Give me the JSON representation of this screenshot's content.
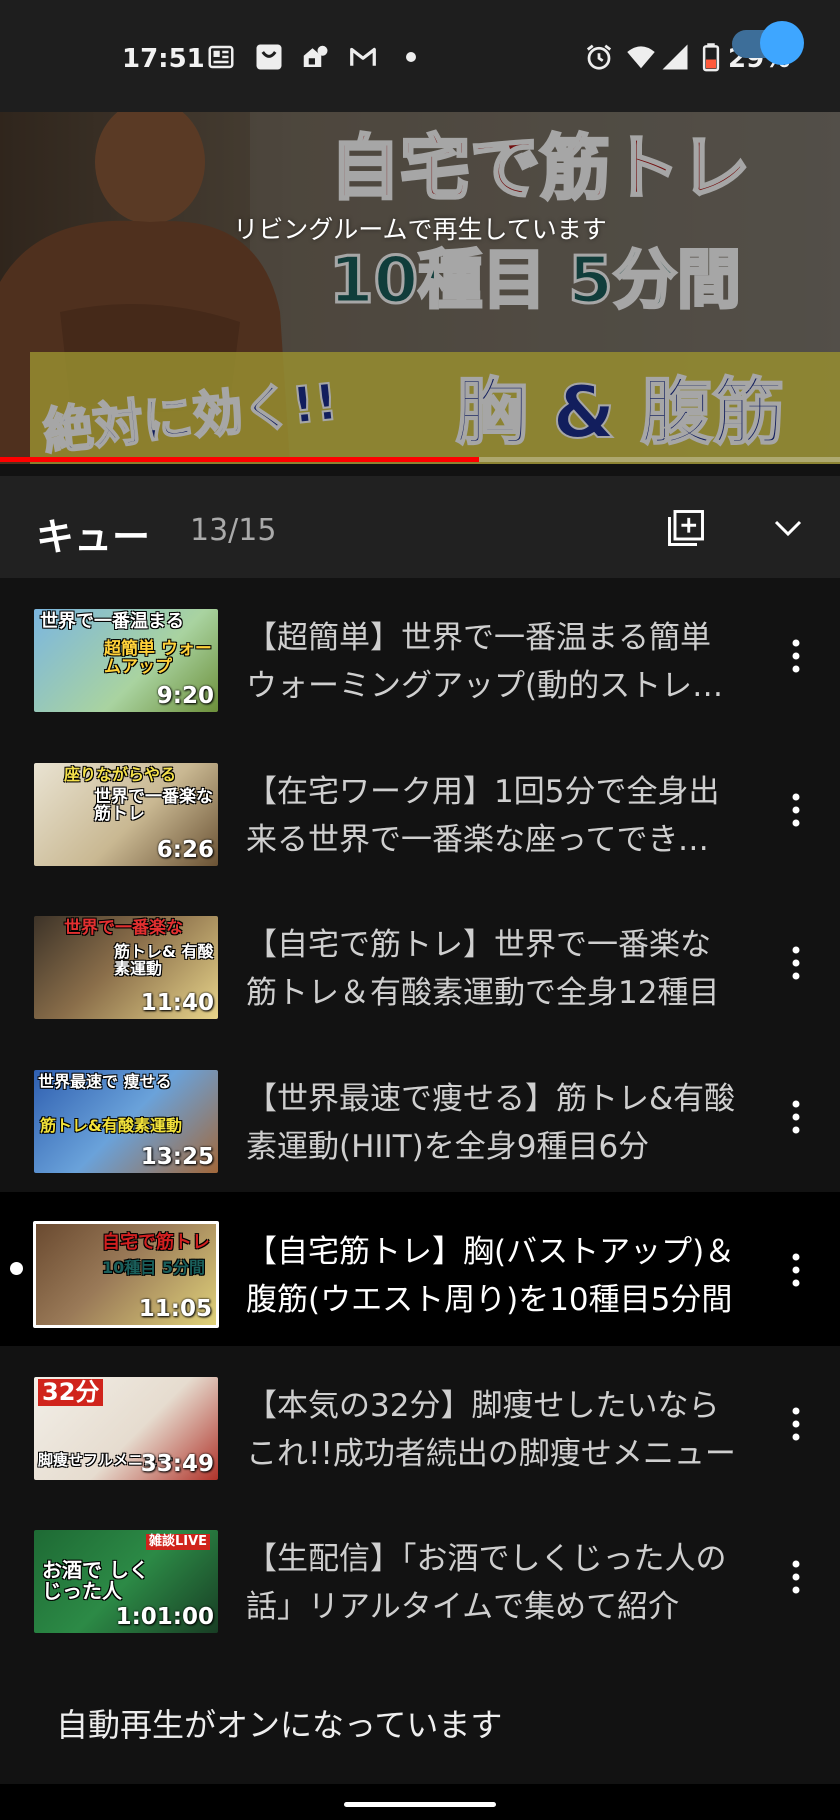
{
  "status_bar": {
    "time": "17:51",
    "battery": "29%",
    "icons": [
      "news-icon",
      "shopping-bag-icon",
      "home-app-icon",
      "gmail-icon",
      "notification-dot-icon",
      "alarm-icon",
      "wifi-icon",
      "signal-icon",
      "battery-icon"
    ]
  },
  "player": {
    "casting_text": "リビングルームで再生しています",
    "thumbnail_text": {
      "line1": "自宅で筋トレ",
      "line2": "10種目 5分間",
      "line3a": "絶対に効く!!",
      "line3b": "胸 & 腹筋"
    },
    "progress": 0.57,
    "progress_color": "#ff0000"
  },
  "queue": {
    "title": "キュー",
    "count": "13/15",
    "items": [
      {
        "title": "【超簡単】世界で一番温まる簡単ウォーミングアップ(動的ストレッチ)",
        "duration": "9:20",
        "thumb_text": "世界で一番温まる",
        "thumb_text2": "超簡単 ウォームアップ",
        "current": false
      },
      {
        "title": "【在宅ワーク用】1回5分で全身出来る世界で一番楽な座ってできる筋トレ",
        "duration": "6:26",
        "thumb_text": "座りながらやる",
        "thumb_text2": "世界で一番楽な 筋トレ",
        "current": false
      },
      {
        "title": "【自宅で筋トレ】世界で一番楽な筋トレ＆有酸素運動で全身12種目",
        "duration": "11:40",
        "thumb_text": "世界で一番楽な",
        "thumb_text2": "筋トレ& 有酸素運動",
        "current": false
      },
      {
        "title": "【世界最速で痩せる】筋トレ&有酸素運動(HIIT)を全身9種目6分",
        "duration": "13:25",
        "thumb_text": "世界最速で 痩せる",
        "thumb_text2": "筋トレ&有酸素運動",
        "current": false
      },
      {
        "title": "【自宅筋トレ】胸(バストアップ)＆腹筋(ウエスト周り)を10種目5分間",
        "duration": "11:05",
        "thumb_text": "自宅で筋トレ",
        "thumb_text2": "10種目 5分間",
        "current": true
      },
      {
        "title": "【本気の32分】脚痩せしたいならこれ!!成功者続出の脚痩せメニュー",
        "duration": "33:49",
        "thumb_text": "32分",
        "thumb_text2": "脚痩せフルメニュー",
        "current": false
      },
      {
        "title": "【生配信】「お酒でしくじった人の話」リアルタイムで集めて紹介",
        "duration": "1:01:00",
        "thumb_text": "お酒で しくじった人",
        "thumb_text2": "雑談LIVE",
        "current": false
      }
    ]
  },
  "autoplay": {
    "label": "自動再生がオンになっています",
    "enabled": true,
    "accent": "#3ea6ff"
  }
}
